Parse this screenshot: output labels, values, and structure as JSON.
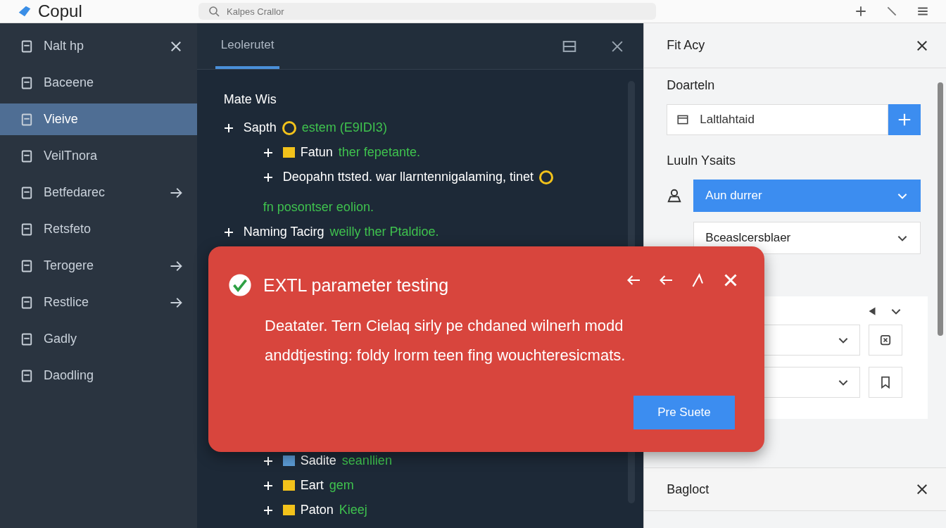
{
  "top_bar": {
    "logo": "Copul",
    "search": {
      "placeholder": "Kalpes Crallor"
    }
  },
  "sidebar": {
    "items": [
      {
        "label": "Nalt hp",
        "selected": false,
        "kind": "closable"
      },
      {
        "label": "Baceene",
        "selected": false
      },
      {
        "label": "Vieive",
        "selected": true
      },
      {
        "label": "VeilTnora",
        "selected": false
      },
      {
        "label": "Betfedarec",
        "selected": false,
        "kind": "expandable"
      },
      {
        "label": "Retsfeto",
        "selected": false
      },
      {
        "label": "Terogere",
        "selected": false,
        "kind": "expandable"
      },
      {
        "label": "Restlice",
        "selected": false,
        "kind": "expandable"
      },
      {
        "label": "Gadly",
        "selected": false
      },
      {
        "label": "Daodling",
        "selected": false
      }
    ]
  },
  "editor": {
    "tabs": [
      {
        "label": "Leolerutet",
        "selected": true
      }
    ],
    "heading": "Mate Wis",
    "tree": [
      {
        "label": "Sapth",
        "kind": "round",
        "color": "#f2c21b",
        "note": "estem (E9IDI3)",
        "children": [
          {
            "label": "Fatun",
            "kind": "square",
            "color": "#f2c21b",
            "note": "ther fepetante."
          },
          {
            "label": "Deopahn ttsted. war llarntennigalaming, tinet",
            "kind": "round",
            "color": "#f2c21b",
            "note": "fn posontser eolion."
          }
        ]
      },
      {
        "label": "Naming Tacirg",
        "note": "weilly ther Ptaldioe."
      }
    ],
    "tree_below": [
      {
        "label": "Sadite",
        "kind": "square",
        "color": "#5b9bd5",
        "note": "seanllien"
      },
      {
        "label": "Eart",
        "kind": "square",
        "color": "#f2c21b",
        "note": "gem"
      },
      {
        "label": "Paton",
        "kind": "square",
        "color": "#f2c21b",
        "note": "Kieej"
      }
    ]
  },
  "inspector": {
    "title": "Fit Acy",
    "section": "Doarteln",
    "field": {
      "value": "Laltlahtaid"
    },
    "group_label": "Luuln Ysaits",
    "selects": [
      {
        "value": "Aun durrer",
        "selected": true
      },
      {
        "value": "Bceaslcersblaer",
        "selected": false
      }
    ],
    "bottom_panel": {
      "title": "Bagloct"
    }
  },
  "toast": {
    "title": "EXTL parameter testing",
    "message": "Deatater. Tern Cielaq sirly pe chdaned wilnerh modd anddtjesting: foldy lrorm teen fing wouchteresicmats.",
    "button": "Pre Suete"
  }
}
